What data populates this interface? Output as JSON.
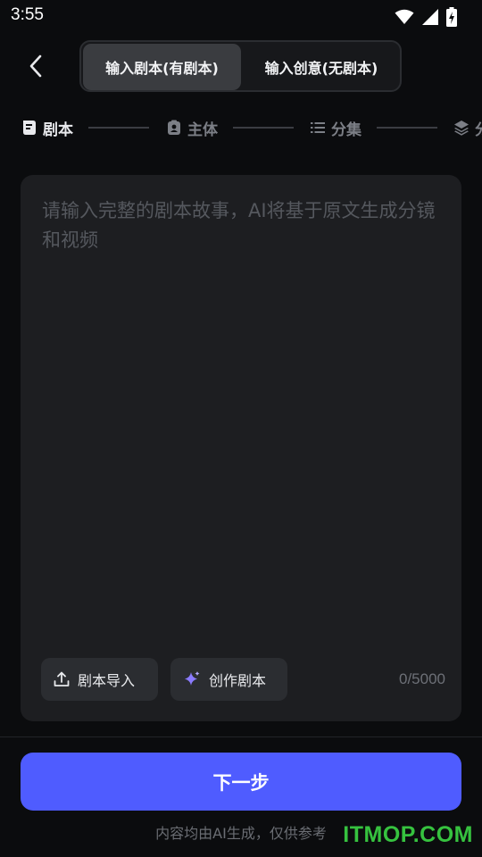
{
  "status_bar": {
    "time": "3:55"
  },
  "header": {
    "tabs": [
      {
        "label": "输入剧本(有剧本)",
        "active": true
      },
      {
        "label": "输入创意(无剧本)",
        "active": false
      }
    ]
  },
  "stepper": {
    "steps": [
      {
        "label": "剧本",
        "icon": "script-icon",
        "active": true
      },
      {
        "label": "主体",
        "icon": "subject-icon",
        "active": false
      },
      {
        "label": "分集",
        "icon": "list-icon",
        "active": false
      },
      {
        "label": "分",
        "icon": "layers-icon",
        "active": false
      }
    ]
  },
  "editor": {
    "placeholder": "请输入完整的剧本故事，AI将基于原文生成分镜和视频",
    "value": "",
    "counter": "0/5000"
  },
  "actions": {
    "import_label": "剧本导入",
    "create_label": "创作剧本"
  },
  "footer": {
    "next_label": "下一步",
    "disclaimer": "内容均由AI生成，仅供参考"
  },
  "watermark": "ITMOP.COM",
  "colors": {
    "accent": "#4f5cff",
    "sparkle": "#8b7bff",
    "watermark": "#36c23f"
  }
}
